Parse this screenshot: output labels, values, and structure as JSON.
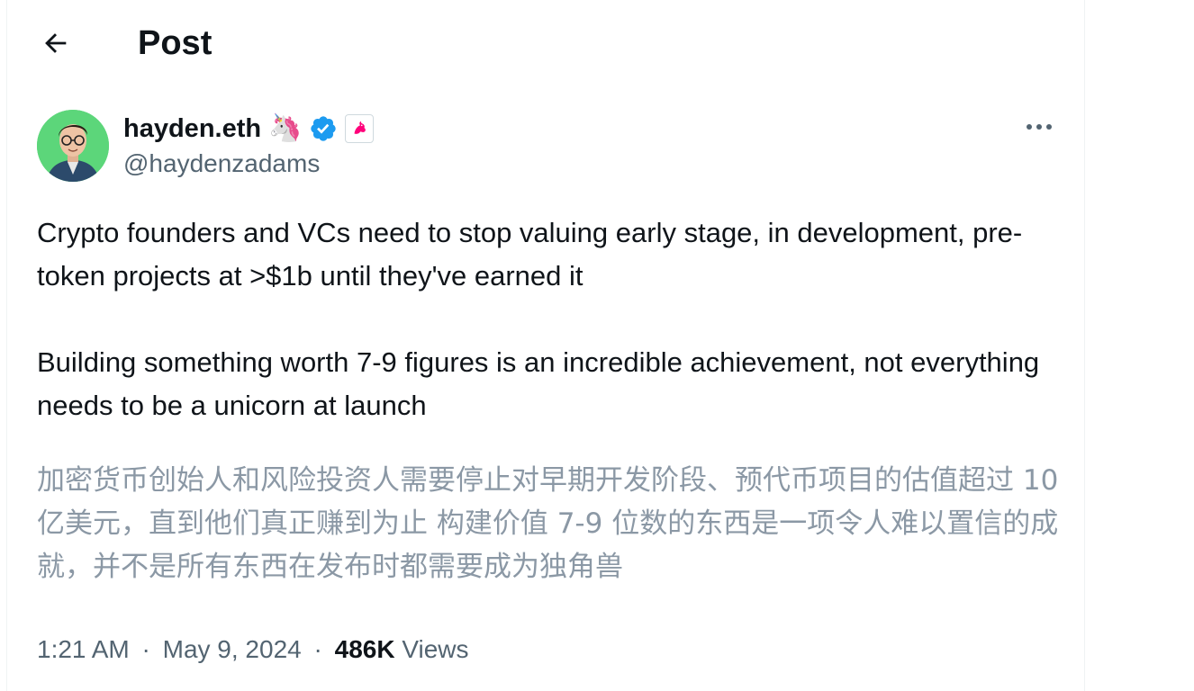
{
  "header": {
    "title": "Post",
    "back_icon": "arrow-left-icon"
  },
  "author": {
    "display_name": "hayden.eth",
    "handle": "@haydenzadams",
    "emoji": "🦄",
    "verified_icon": "verified-badge-icon",
    "affiliate_icon": "uniswap-unicorn-icon",
    "avatar_bg": "#5cd67a"
  },
  "tweet": {
    "paragraphs": [
      "Crypto founders and VCs need to stop valuing early stage, in development, pre-token projects at >$1b until they've earned it",
      "Building something worth 7-9 figures is an incredible achievement, not everything needs to be a unicorn at launch"
    ],
    "translation": "加密货币创始人和风险投资人需要停止对早期开发阶段、预代币项目的估值超过 10 亿美元，直到他们真正赚到为止 构建价值 7-9 位数的东西是一项令人难以置信的成就，并不是所有东西在发布时都需要成为独角兽"
  },
  "meta": {
    "time": "1:21 AM",
    "separator": "·",
    "date": "May 9, 2024",
    "views_count": "486K",
    "views_label": "Views"
  },
  "colors": {
    "primary_text": "#0f1419",
    "secondary_text": "#536471",
    "translation_text": "#8b98a5",
    "verified_blue": "#1d9bf0"
  }
}
